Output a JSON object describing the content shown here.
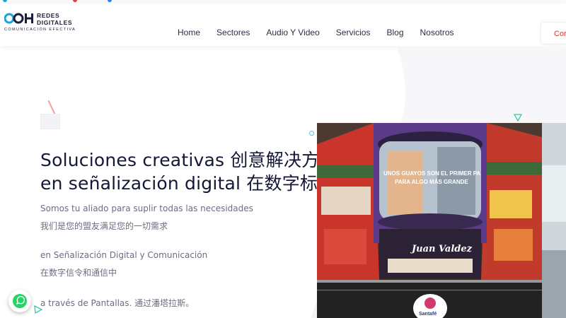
{
  "header": {
    "logo": {
      "line1": "REDES",
      "line2": "DIGITALES",
      "tagline": "COMUNICACIÓN EFECTIVA"
    },
    "nav": [
      "Home",
      "Sectores",
      "Audio Y Video",
      "Servicios",
      "Blog",
      "Nosotros"
    ],
    "contact_label": "Cor"
  },
  "hero": {
    "title_line1": "Soluciones creativas  创意解决方",
    "title_line2": "en señalización digital 在数字标牌",
    "paragraphs": [
      "Somos tu aliado para suplir todas las necesidades",
      "我们是您的盟友满足您的一切需求",
      "en Señalización Digital y Comunicación",
      "在数字信令和通信中",
      "a través de Pantallas. 通过潘塔拉斯。"
    ]
  },
  "image": {
    "screen_text_1": "UNOS GUAYOS SON EL PRIMER PA",
    "screen_text_2": "PARA ALGO MÁS GRANDE",
    "store_name": "Juan Valdez",
    "mall_name": "Santafé"
  },
  "colors": {
    "brand_blue": "#1aa5d6",
    "brand_navy": "#1b1d3a",
    "accent_red": "#e2342b",
    "whatsapp_green": "#25d366"
  }
}
